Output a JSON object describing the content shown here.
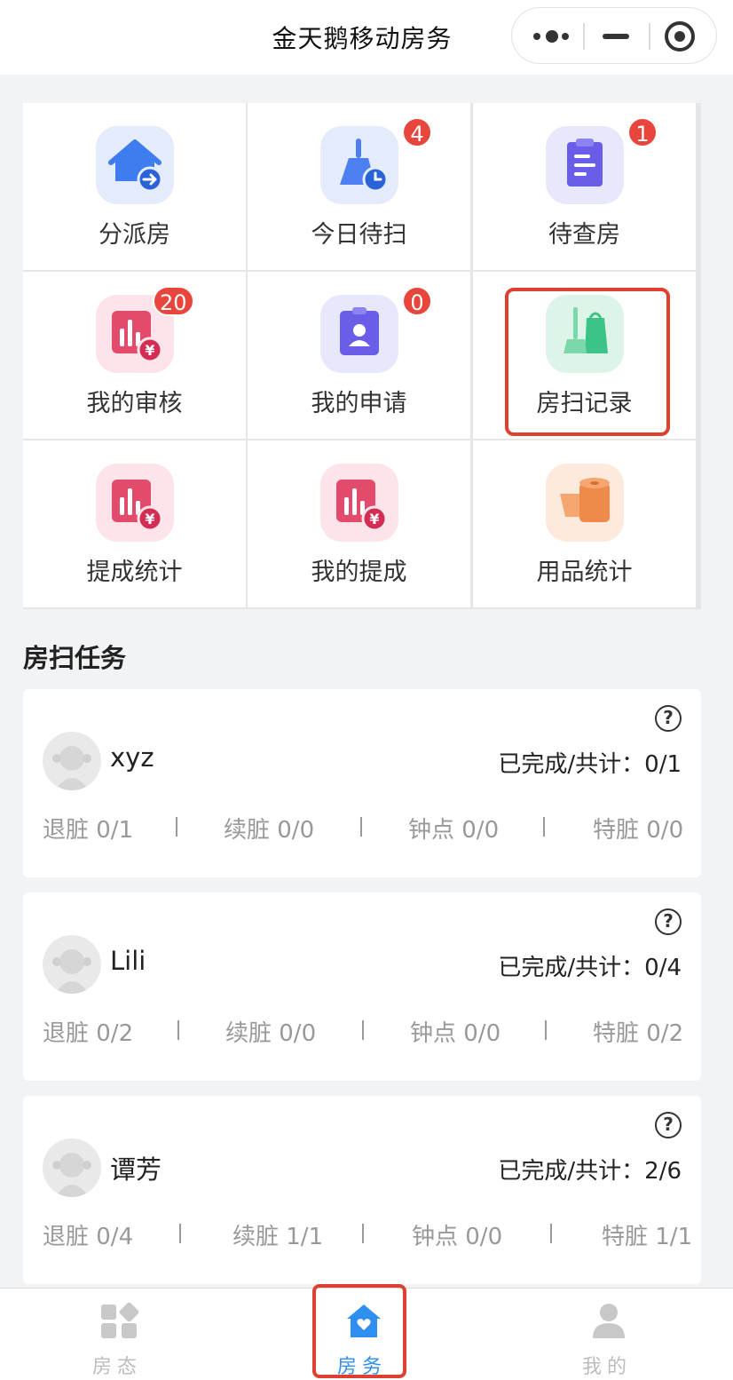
{
  "header": {
    "title": "金天鹅移动房务"
  },
  "menu": [
    {
      "label": "分派房",
      "icon": "house-assign-icon",
      "badge": ""
    },
    {
      "label": "今日待扫",
      "icon": "broom-clock-icon",
      "badge": "4"
    },
    {
      "label": "待查房",
      "icon": "clipboard-icon",
      "badge": "1"
    },
    {
      "label": "我的审核",
      "icon": "chart-yen-icon",
      "badge": "20"
    },
    {
      "label": "我的申请",
      "icon": "id-badge-icon",
      "badge": "0"
    },
    {
      "label": "房扫记录",
      "icon": "broom-bag-icon",
      "badge": ""
    },
    {
      "label": "提成统计",
      "icon": "chart-yen-icon",
      "badge": ""
    },
    {
      "label": "我的提成",
      "icon": "chart-yen-icon",
      "badge": ""
    },
    {
      "label": "用品统计",
      "icon": "tissue-roll-icon",
      "badge": ""
    }
  ],
  "section": {
    "title": "房扫任务"
  },
  "tasks": [
    {
      "name": "xyz",
      "done": "已完成/共计：0/1",
      "stats": [
        "退脏 0/1",
        "续脏 0/0",
        "钟点 0/0",
        "特脏 0/0"
      ]
    },
    {
      "name": "Lili",
      "done": "已完成/共计：0/4",
      "stats": [
        "退脏 0/2",
        "续脏 0/0",
        "钟点 0/0",
        "特脏 0/2"
      ]
    },
    {
      "name": "谭芳",
      "done": "已完成/共计：2/6",
      "stats": [
        "退脏 0/4",
        "续脏 1/1",
        "钟点 0/0",
        "特脏 1/1"
      ]
    }
  ],
  "help_symbol": "?",
  "tabbar": [
    {
      "label": "房态",
      "icon": "room-status-icon",
      "active": false
    },
    {
      "label": "房务",
      "icon": "house-heart-icon",
      "active": true
    },
    {
      "label": "我的",
      "icon": "person-icon",
      "active": false
    }
  ],
  "colors": {
    "accent": "#2f8ff0",
    "badge": "#e8453c",
    "highlight": "#e0402f"
  }
}
